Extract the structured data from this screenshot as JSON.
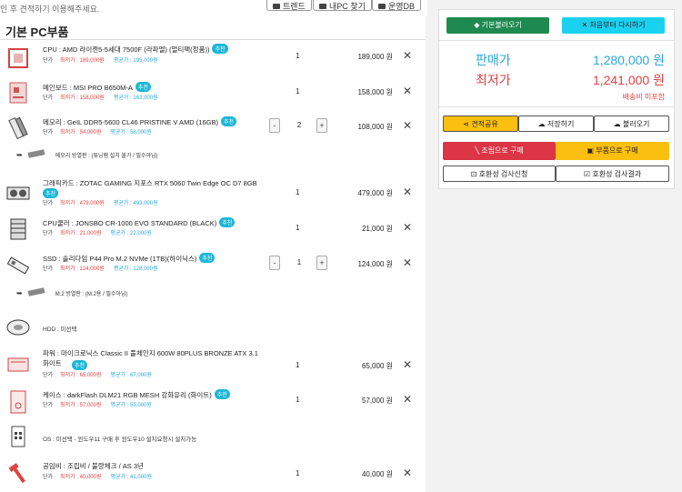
{
  "top": {
    "note": "인 후 견적하기 이용해주세요.",
    "buttons": [
      {
        "label": "트렌드",
        "icon": "trend-icon"
      },
      {
        "label": "내PC 찾기",
        "icon": "search-icon"
      },
      {
        "label": "운영DB",
        "icon": "chart-icon"
      }
    ]
  },
  "section_title": "기본 PC부품",
  "parts": [
    {
      "name": "CPU : AMD 라이젠5-5세대 7500F (라파엘) (멀티팩(정품))",
      "badge": "추천",
      "price_label": "단가",
      "lowest": "최저가 : 189,000원",
      "average": "평균가 : 195,000원",
      "qty": "1",
      "price": "189,000 원",
      "icon": "cpu-icon"
    },
    {
      "name": "메인보드 : MSI PRO B650M-A",
      "badge": "추천",
      "price_label": "단가",
      "lowest": "최저가 : 158,000원",
      "average": "평균가 : 163,000원",
      "qty": "1",
      "price": "158,000 원",
      "icon": "motherboard-icon"
    },
    {
      "name": "메모리 : GeIL DDR5-5600 CL46 PRISTINE V AMD (16GB)",
      "badge": "추천",
      "price_label": "단가",
      "lowest": "최저가 : 54,000원",
      "average": "평균가 : 56,000원",
      "qty": "2",
      "price": "108,000 원",
      "icon": "memory-icon"
    },
    {
      "name": "그래픽카드 : ZOTAC GAMING 지포스 RTX 5060 Twin Edge OC D7 8GB",
      "badge": "추천",
      "price_label": "단가",
      "lowest": "최저가 : 479,000원",
      "average": "평균가 : 493,000원",
      "qty": "1",
      "price": "479,000 원",
      "icon": "gpu-icon"
    },
    {
      "name": "CPU쿨러 : JONSBO CR-1000 EVO STANDARD (BLACK)",
      "badge": "추천",
      "price_label": "단가",
      "lowest": "최저가 : 21,000원",
      "average": "평균가 : 22,000원",
      "qty": "1",
      "price": "21,000 원",
      "icon": "cooler-icon"
    },
    {
      "name": "SSD : 솔리다임 P44 Pro M.2 NVMe (1TB)(하이닉스)",
      "badge": "추천",
      "price_label": "단가",
      "lowest": "최저가 : 124,000원",
      "average": "평균가 : 128,000원",
      "qty": "1",
      "price": "124,000 원",
      "icon": "ssd-icon"
    },
    {
      "name": "파워 : 마이크로닉스 Classic II 풀체인지 600W 80PLUS BRONZE ATX 3.1 화이트",
      "badge": "추천",
      "price_label": "단가",
      "lowest": "최저가 : 65,000원",
      "average": "평균가 : 67,000원",
      "qty": "1",
      "price": "65,000 원",
      "icon": "psu-icon"
    },
    {
      "name": "케이스 : darkFlash DLM21 RGB MESH 강화유리 (화이트)",
      "badge": "추천",
      "price_label": "단가",
      "lowest": "최저가 : 57,000원",
      "average": "평균가 : 59,000원",
      "qty": "1",
      "price": "57,000 원",
      "icon": "case-icon"
    },
    {
      "name": "공임비 : 조립비 / 불량체크 / AS 3년",
      "badge": "",
      "price_label": "단가",
      "lowest": "최저가 : 40,000원",
      "average": "평균가 : 41,000원",
      "qty": "1",
      "price": "40,000 원",
      "icon": "tool-icon"
    }
  ],
  "subs": {
    "memory_heatsink": "메모리 방열판 : (튜닝램 설치 불가 / 필수아님)",
    "m2_heatsink": "M.2 방열판 : (M.2용 / 필수아님)"
  },
  "plain_rows": {
    "hdd": "HDD : 미선택",
    "os": "OS : 미선택 - 윈도우11 구매 후 윈도우10 설치요청시 설치가능"
  },
  "delete_glyph": "✕",
  "stepper": {
    "minus": "-",
    "plus": "+"
  },
  "summary": {
    "load_default": "기본불러오기",
    "reset": "✕ 처음부터 다시하기",
    "sale_label": "판매가",
    "sale_value": "1,280,000 원",
    "lowest_label": "최저가",
    "lowest_value": "1,241,000 원",
    "shipping": "배송비 미포함",
    "share": "견적공유",
    "save": "저장하기",
    "load": "불러오기",
    "buy_assembled": "조립으로 구매",
    "buy_parts": "부품으로 구매",
    "compat_request": "호환성 검사신청",
    "compat_result": "호환성 검사결과"
  },
  "colors": {
    "green": "#1e8a4f",
    "cyan": "#1ad2f0",
    "red": "#dc3545",
    "yellow": "#fbbf10",
    "blue": "#28a8dd"
  }
}
